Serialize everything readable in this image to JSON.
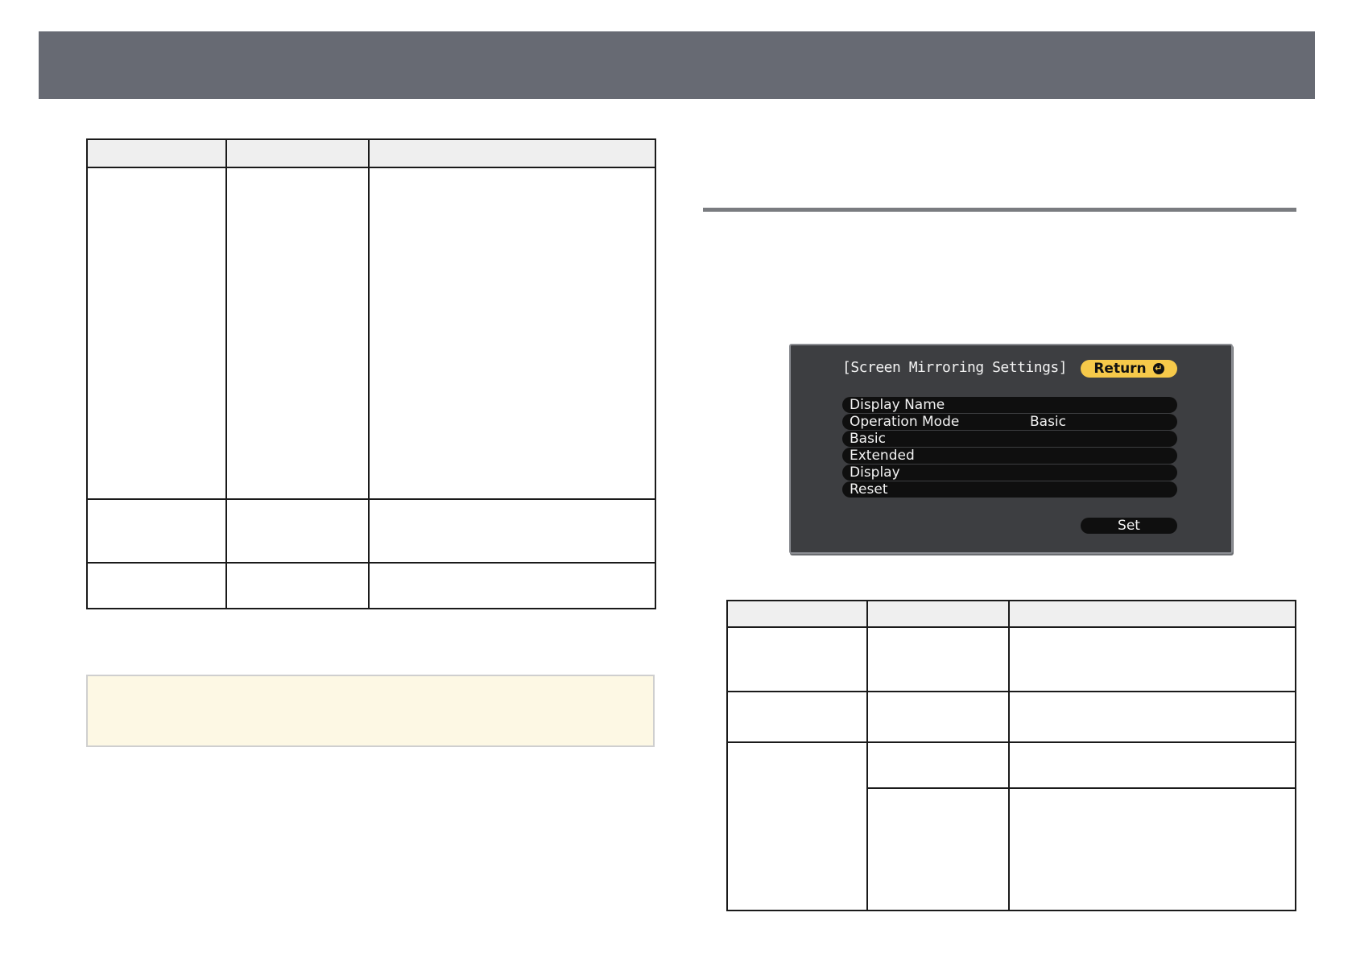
{
  "osd": {
    "title": "[Screen Mirroring Settings]",
    "return_label": "Return",
    "menu_items": [
      {
        "label": "Display Name",
        "value": ""
      },
      {
        "label": "Operation Mode",
        "value": "Basic"
      },
      {
        "label": "Basic",
        "value": ""
      },
      {
        "label": "Extended",
        "value": ""
      },
      {
        "label": "Display",
        "value": ""
      },
      {
        "label": "Reset",
        "value": ""
      }
    ],
    "set_label": "Set"
  },
  "colors": {
    "header_bar": "#676a73",
    "osd_return": "#f6c94a",
    "note_background": "#fdf8e4"
  }
}
